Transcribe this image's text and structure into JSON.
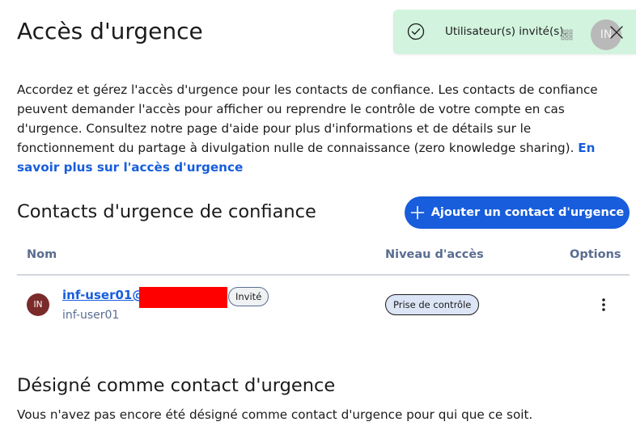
{
  "page": {
    "title": "Accès d'urgence",
    "intro": "Accordez et gérez l'accès d'urgence pour les contacts de confiance. Les contacts de confiance peuvent demander l'accès pour afficher ou reprendre le contrôle de votre compte en cas d'urgence. Consultez notre page d'aide pour plus d'informations et de détails sur le fonctionnement du partage à divulgation nulle de connaissance (zero knowledge sharing).",
    "learn_more": "En savoir plus sur l'accès d'urgence"
  },
  "trusted": {
    "title": "Contacts d'urgence de confiance",
    "add_button": "Ajouter un contact d'urgence",
    "columns": {
      "name": "Nom",
      "access": "Niveau d'accès",
      "options": "Options"
    },
    "rows": [
      {
        "initials": "IN",
        "email": "inf-user01@",
        "status": "Invité",
        "username": "inf-user01",
        "access": "Prise de contrôle"
      }
    ]
  },
  "designated": {
    "title": "Désigné comme contact d'urgence",
    "empty": "Vous n'avez pas encore été désigné comme contact d'urgence pour qui que ce soit."
  },
  "toast": {
    "message": "Utilisateur(s) invité(s).",
    "avatar": "IN"
  },
  "colors": {
    "primary": "#175ddc",
    "toast_bg": "#d2f3de",
    "avatar": "#7b2a2a",
    "muted": "#5a6d91"
  },
  "icons": {
    "toast": "check-circle-icon",
    "add": "plus-icon",
    "options": "kebab-menu-icon",
    "close": "close-icon"
  }
}
